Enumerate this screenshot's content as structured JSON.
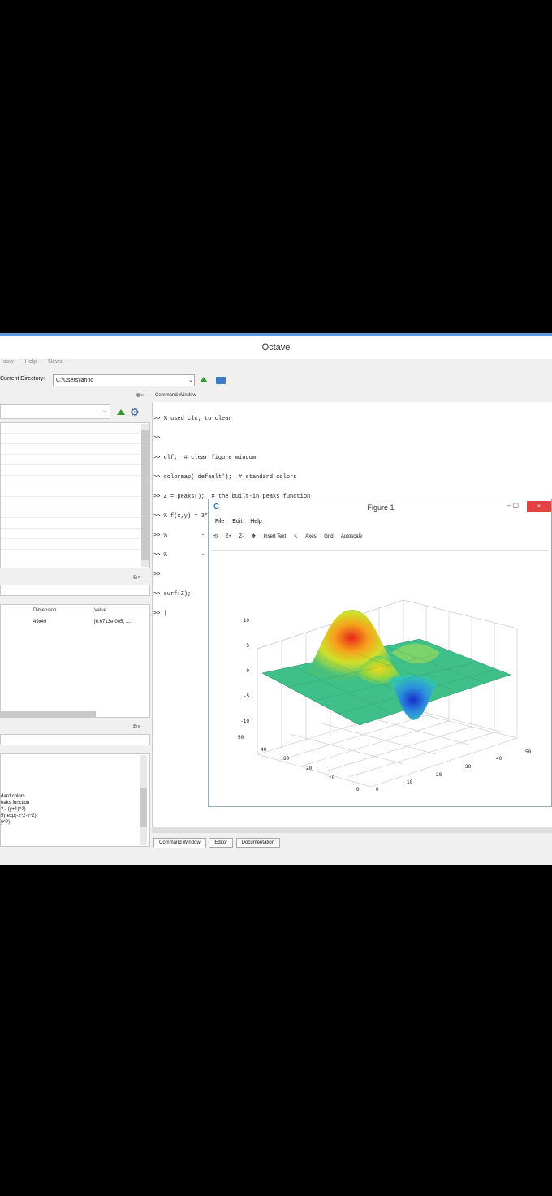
{
  "window": {
    "title": "Octave"
  },
  "menubar": {
    "items": [
      "dow",
      "Help",
      "News"
    ]
  },
  "dirbar": {
    "label": "Current Directory:",
    "path": "C:\\Users\\jannc"
  },
  "left": {
    "workspace_headers": {
      "dimension": "Dimension",
      "value": "Value"
    },
    "workspace_row": {
      "dimension": "49x49",
      "value": "[6.6713e-005, 1..."
    },
    "history_lines": [
      "dard colors",
      "eaks function",
      "2 - (y+1)^2)",
      "5)*exp(-x^2-y^2)",
      "y^2)"
    ]
  },
  "command": {
    "header": "Command Window",
    "lines": [
      ">> % used clc; to clear",
      ">>",
      ">> clf;  # clear figure window",
      ">> colormap('default');  # standard colors",
      ">> Z = peaks();  # the built-in peaks function",
      ">> % f(x,y) = 3*(1-x)^2*exp(-x^2 - (y+1)^2)",
      ">> %          - 10*(x/5 - x^3 - y^5)*exp(-x^2-y^2)",
      ">> %          - 1/3*exp(-(x+1)^2 - y^2)",
      ">>",
      ">> surf(Z);",
      ">> |"
    ],
    "tabs": [
      "Command Window",
      "Editor",
      "Documentation"
    ]
  },
  "figure": {
    "title": "Figure 1",
    "menu": [
      "File",
      "Edit",
      "Help"
    ],
    "toolbar": [
      "Z+",
      "Z-",
      "Insert Text",
      "Axes",
      "Grid",
      "Autoscale"
    ],
    "z_ticks": [
      "10",
      "5",
      "0",
      "-5",
      "-10"
    ],
    "y_ticks": [
      "50",
      "40",
      "30",
      "20",
      "10",
      "0"
    ],
    "x_ticks": [
      "0",
      "10",
      "20",
      "30",
      "40",
      "50"
    ]
  },
  "colors": {
    "accent": "#5b9bd5",
    "close": "#e04343"
  }
}
